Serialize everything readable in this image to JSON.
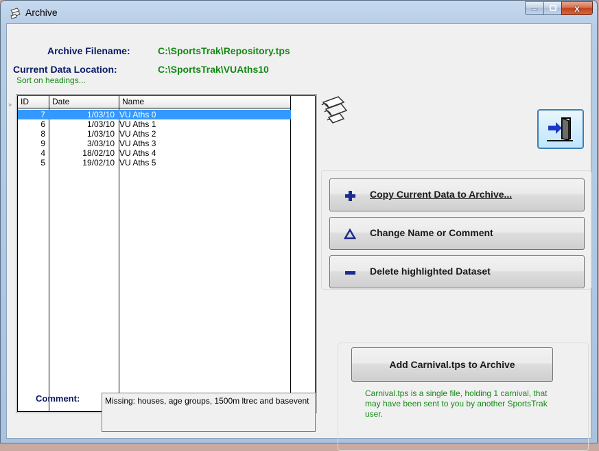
{
  "window": {
    "title": "Archive",
    "close_glyph": "x"
  },
  "header": {
    "archive_filename_label": "Archive Filename:",
    "archive_filename_value": "C:\\SportsTrak\\Repository.tps",
    "data_location_label": "Current Data Location:",
    "data_location_value": "C:\\SportsTrak\\VUAths10"
  },
  "grid": {
    "sort_hint": "Sort on headings...",
    "row_indicator": "»",
    "columns": [
      "ID",
      "Date",
      "Name"
    ],
    "rows": [
      {
        "id": "7",
        "date": "1/03/10",
        "name": "VU Aths 0",
        "selected": true
      },
      {
        "id": "6",
        "date": "1/03/10",
        "name": "VU Aths 1"
      },
      {
        "id": "8",
        "date": "1/03/10",
        "name": "VU Aths 2"
      },
      {
        "id": "9",
        "date": "3/03/10",
        "name": "VU Aths 3"
      },
      {
        "id": "4",
        "date": "18/02/10",
        "name": "VU Aths 4"
      },
      {
        "id": "5",
        "date": "19/02/10",
        "name": "VU Aths 5"
      }
    ]
  },
  "actions": {
    "copy": {
      "label": "Copy Current Data to Archive...",
      "icon": "plus-icon"
    },
    "rename": {
      "label": "Change Name or Comment",
      "icon": "triangle-icon"
    },
    "delete": {
      "label": "Delete highlighted Dataset",
      "icon": "minus-icon"
    }
  },
  "carnival": {
    "button_label": "Add Carnival.tps to Archive",
    "note": "Carnival.tps is a single file, holding 1 carnival, that may have been sent to you by another SportsTrak user."
  },
  "comment": {
    "label": "Comment:",
    "text": "Missing: houses, age groups,  1500m ltrec and basevent"
  },
  "colors": {
    "label_blue": "#0a1a66",
    "value_green": "#138a13",
    "selection": "#3399ff",
    "icon_blue": "#1b2c8c"
  }
}
